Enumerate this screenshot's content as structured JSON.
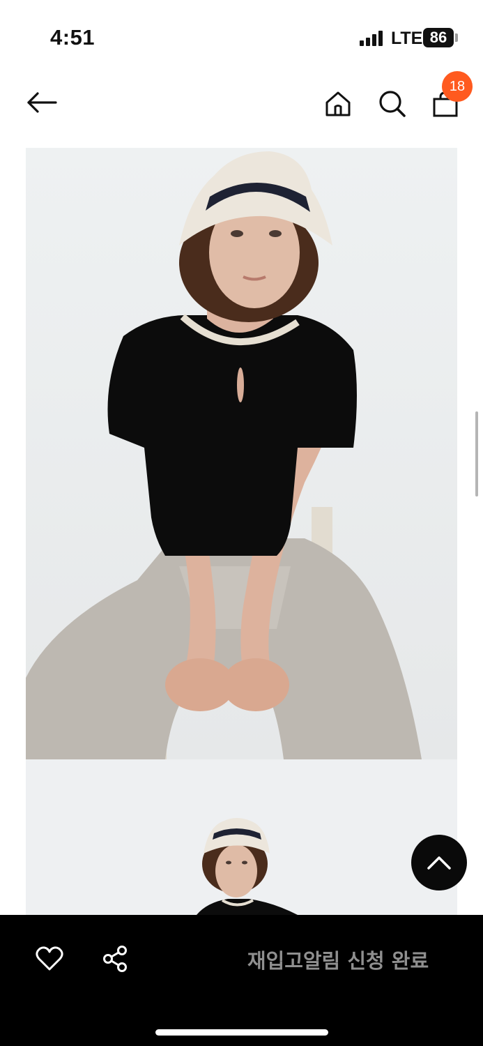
{
  "status_bar": {
    "time": "4:51",
    "network": "LTE",
    "battery": "86"
  },
  "nav": {
    "back_icon": "arrow-left-icon",
    "home_icon": "home-icon",
    "search_icon": "search-icon",
    "cart_icon": "shopping-bag-icon",
    "cart_count": "18",
    "badge_color": "#ff5a1f"
  },
  "images": [
    {
      "name": "product-photo-1",
      "description_icon": "model-seated-photo"
    },
    {
      "name": "product-photo-2",
      "description_icon": "model-full-body-photo"
    }
  ],
  "scroll_top_icon": "chevron-up-icon",
  "bottom_bar": {
    "like_icon": "heart-icon",
    "share_icon": "share-icon",
    "restock_label": "재입고알림 신청 완료"
  }
}
